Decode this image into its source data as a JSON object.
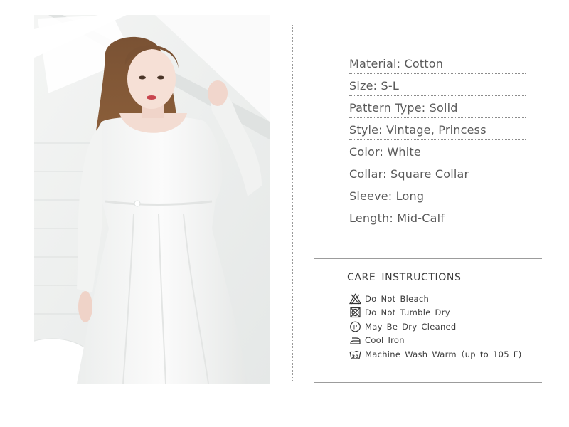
{
  "specs": [
    {
      "label": "Material: Cotton"
    },
    {
      "label": "Size: S-L"
    },
    {
      "label": "Pattern Type: Solid"
    },
    {
      "label": "Style: Vintage, Princess"
    },
    {
      "label": "Color: White"
    },
    {
      "label": "Collar: Square Collar"
    },
    {
      "label": "Sleeve: Long"
    },
    {
      "label": "Length: Mid-Calf"
    }
  ],
  "care": {
    "title": "CARE  INSTRUCTIONS",
    "items": [
      {
        "icon": "do-not-bleach-icon",
        "label": "Do  Not  Bleach"
      },
      {
        "icon": "do-not-tumble-dry-icon",
        "label": "Do  Not  Tumble  Dry"
      },
      {
        "icon": "dry-clean-p-icon",
        "label": "May  Be  Dry  Cleaned"
      },
      {
        "icon": "iron-icon",
        "label": "Cool  Iron"
      },
      {
        "icon": "wash-30-icon",
        "label": "Machine  Wash  Warm（up  to  105  F)"
      }
    ]
  }
}
